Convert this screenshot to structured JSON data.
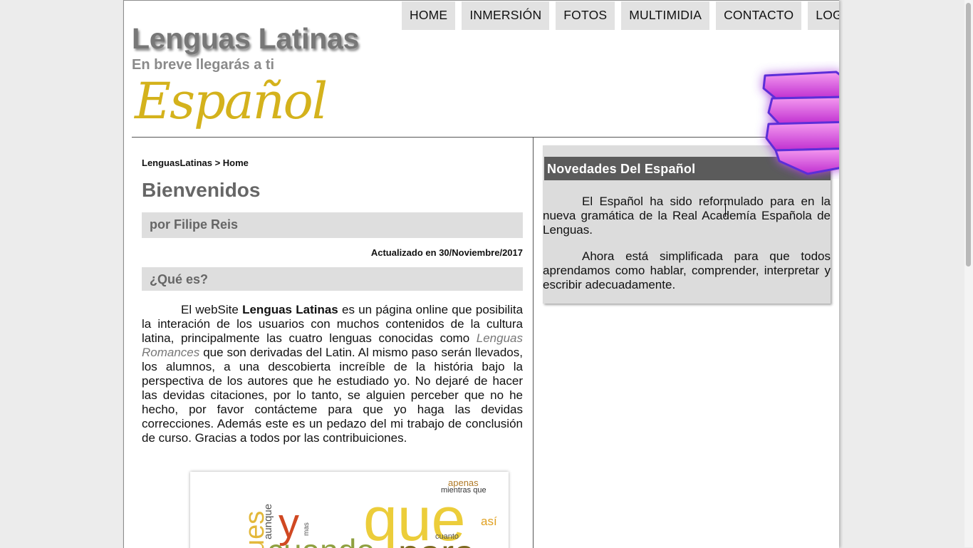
{
  "nav": {
    "items": [
      "HOME",
      "INMERSIÓN",
      "FOTOS",
      "MULTIMIDIA",
      "CONTACTO",
      "LOGINADMIN"
    ]
  },
  "header": {
    "title": "Lenguas Latinas",
    "subtitle": "En breve llegarás a ti",
    "logo_text": "Español"
  },
  "main": {
    "breadcrumb": "LenguasLatinas > Home",
    "heading": "Bienvenidos",
    "author": "por Filipe Reis",
    "updated": "Actualizado en 30/Noviembre/2017",
    "section_title": "¿Qué es?",
    "intro": {
      "part1": "El webSite ",
      "bold": "Lenguas Latinas",
      "part2": " es un página online que posibilita la interación de los usuarios con muchos contenidos de la cultura latina, principalmente las cuatro lenguas conocidas como ",
      "italic": "Lenguas Romances",
      "part3": " que son derivadas del Latin. Al mismo paso serán llevados, los alumnos, a una descobierta increíble de la história bajo la perspectiva de los autores que he estudiado yo. No dejaré de hacer las devidas citaciones, por lo tanto, se alguien perceber que no he hecho, por favor contácteme para que yo haga las devidas correcciones. Además este es un pedazo del mi trabajo de conclusión de curso. Gracias a todos por las contribuiciones."
    },
    "wordcloud": {
      "words": [
        "apenas",
        "mientras que",
        "que",
        "así",
        "y",
        "aunque",
        "mas",
        "cuanto",
        "ues",
        "cuando",
        "para"
      ]
    }
  },
  "sidebar": {
    "title": "Novedades Del Español",
    "para1": "El Español ha sido reformulado para en la nueva gramática de la Real Academía Española de Lenguas.",
    "para2": "Ahora está simplificada para que todos aprendamos como hablar, comprender, interpretar y escribir adecuadamente."
  },
  "colors": {
    "nav_bg": "#e2e2e2",
    "sidebar_header": "#5b5b5b",
    "logo_gold": "#d4b21c",
    "books_magenta": "#e040e0"
  },
  "icons": [
    "books-stack-icon"
  ]
}
